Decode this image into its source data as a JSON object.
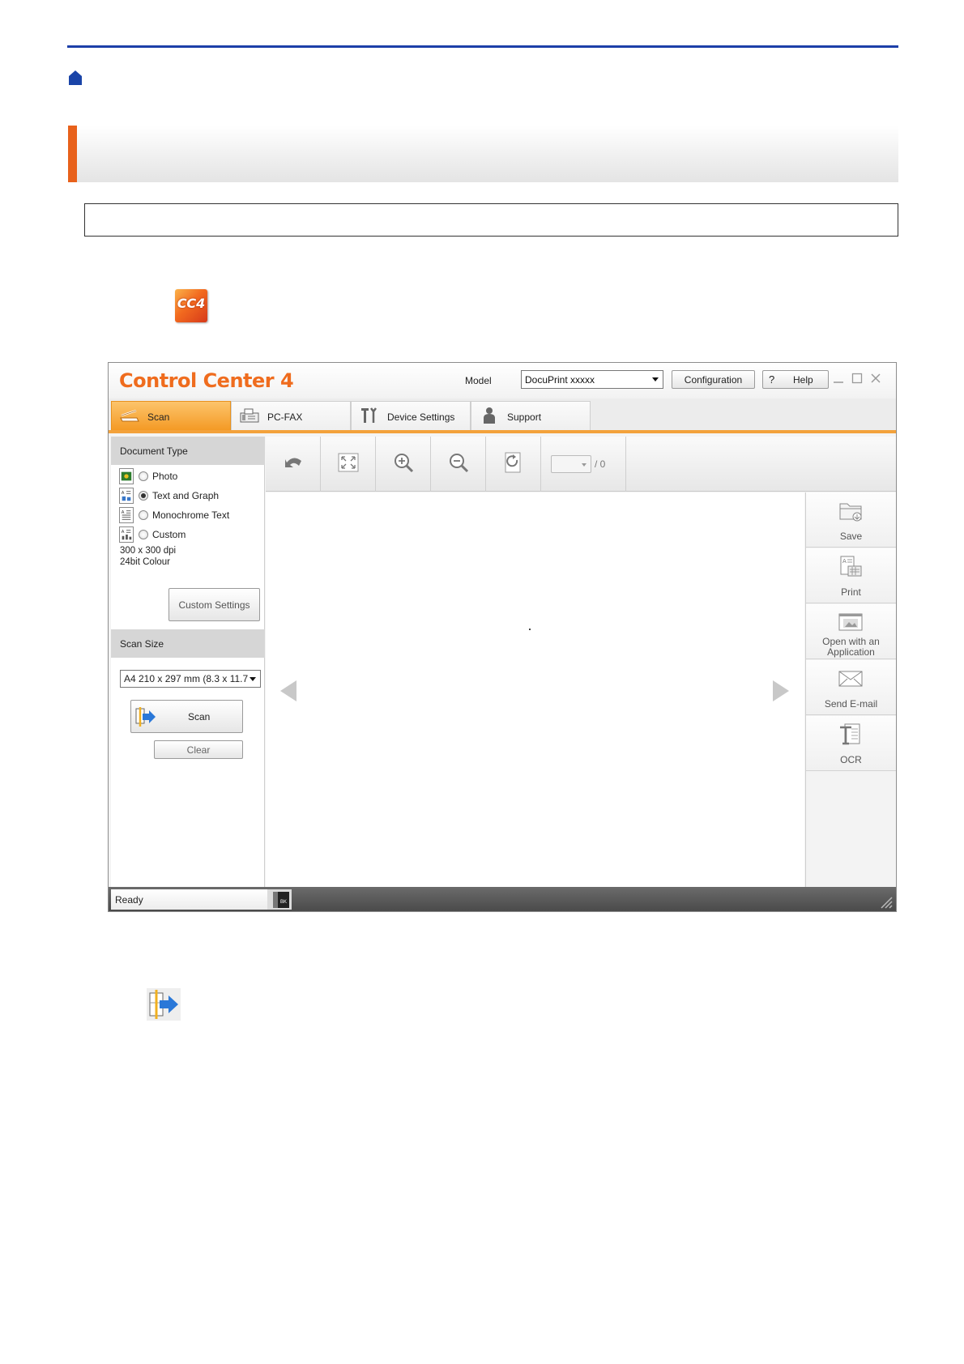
{
  "app": {
    "logo": "Control Center 4",
    "model_label": "Model",
    "model_value": "DocuPrint xxxxx",
    "configuration_label": "Configuration",
    "help_q": "?",
    "help_label": "Help"
  },
  "launcher_icon_text": "CC4",
  "tabs": [
    {
      "label": "Scan",
      "icon": "scanner-icon"
    },
    {
      "label": "PC-FAX",
      "icon": "fax-icon"
    },
    {
      "label": "Device Settings",
      "icon": "tools-icon"
    },
    {
      "label": "Support",
      "icon": "person-icon"
    }
  ],
  "document_type": {
    "heading": "Document Type",
    "options": [
      {
        "label": "Photo",
        "selected": false
      },
      {
        "label": "Text and Graph",
        "selected": true
      },
      {
        "label": "Monochrome Text",
        "selected": false
      },
      {
        "label": "Custom",
        "selected": false
      }
    ],
    "resolution": "300 x 300 dpi",
    "colour": "24bit Colour",
    "custom_settings_label": "Custom Settings"
  },
  "scan_size": {
    "heading": "Scan Size",
    "value": "A4 210 x 297 mm (8.3 x 11.7",
    "scan_label": "Scan",
    "clear_label": "Clear"
  },
  "toolbar": {
    "page_total": "/ 0"
  },
  "actions": [
    {
      "label_line1": "Save",
      "label_line2": "",
      "icon": "folder-icon"
    },
    {
      "label_line1": "Print",
      "label_line2": "",
      "icon": "print-icon"
    },
    {
      "label_line1": "Open with an",
      "label_line2": "Application",
      "icon": "image-icon"
    },
    {
      "label_line1": "Send E-mail",
      "label_line2": "",
      "icon": "envelope-icon"
    },
    {
      "label_line1": "OCR",
      "label_line2": "",
      "icon": "ocr-icon"
    }
  ],
  "status": {
    "text": "Ready",
    "ink": "BK"
  },
  "colors": {
    "rule": "#1c3fa8",
    "accent": "#e8611b",
    "tab_active": "#f49a25"
  }
}
